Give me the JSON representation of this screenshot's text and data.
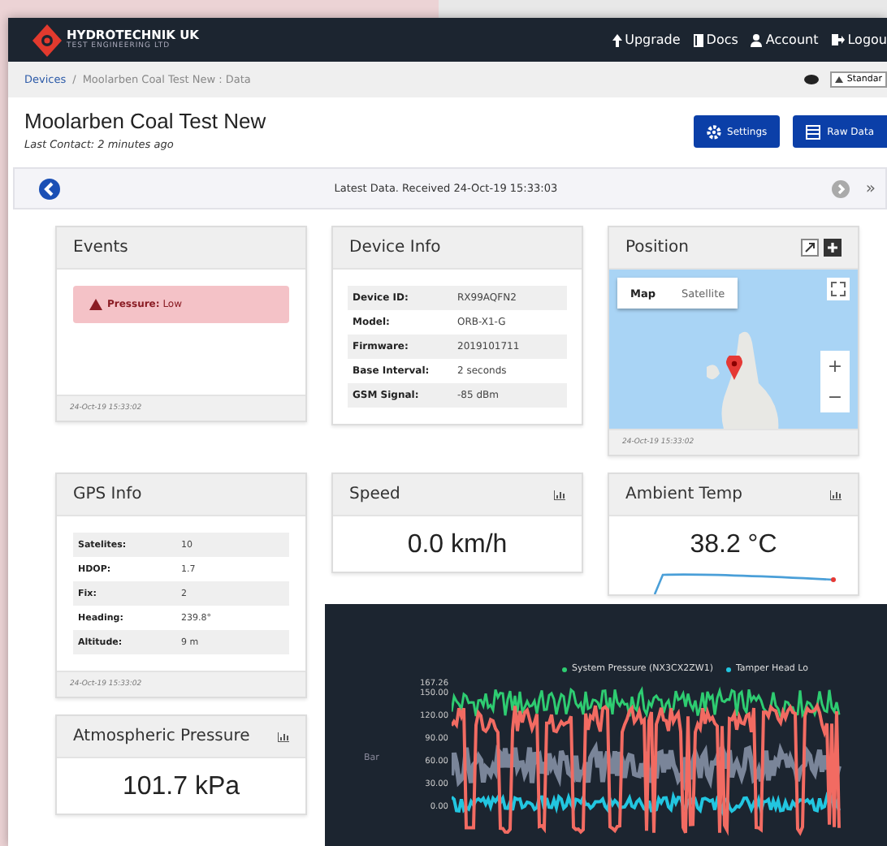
{
  "nav": {
    "brand": "HYDROTECHNIK UK",
    "brand_sub": "TEST ENGINEERING LTD",
    "links": [
      {
        "label": "Upgrade",
        "kind": "upgrade"
      },
      {
        "label": "Docs",
        "kind": "docs"
      },
      {
        "label": "Account",
        "kind": "account"
      },
      {
        "label": "Logou",
        "kind": "logout"
      }
    ]
  },
  "breadcrumb": {
    "items": [
      "Devices",
      "Moolarben Coal Test New : Data"
    ],
    "separator": "/",
    "view_select": "Standar"
  },
  "header": {
    "title": "Moolarben Coal Test New",
    "subtitle": "Last Contact: 2 minutes ago",
    "buttons": [
      {
        "label": "Settings",
        "kind": "settings"
      },
      {
        "label": "Raw Data",
        "kind": "data"
      }
    ]
  },
  "date_nav": {
    "text": "Latest Data. Received 24-Oct-19 15:33:03",
    "next_symbol": "»"
  },
  "events": {
    "title": "Events",
    "alerts": [
      {
        "label": "Pressure:",
        "value": "Low"
      }
    ],
    "footer": "24-Oct-19 15:33:02"
  },
  "device_info": {
    "title": "Device Info",
    "rows": [
      {
        "label": "Device ID:",
        "value": "RX99AQFN2"
      },
      {
        "label": "Model:",
        "value": "ORB-X1-G"
      },
      {
        "label": "Firmware:",
        "value": "2019101711"
      },
      {
        "label": "Base Interval:",
        "value": "2 seconds"
      },
      {
        "label": "GSM Signal:",
        "value": "-85 dBm"
      }
    ]
  },
  "position": {
    "title": "Position",
    "map_types": [
      {
        "label": "Map",
        "selected": true
      },
      {
        "label": "Satellite",
        "selected": false
      }
    ],
    "zoom_in": "+",
    "zoom_out": "−",
    "footer": "24-Oct-19 15:33:02"
  },
  "gps_info": {
    "title": "GPS Info",
    "rows": [
      {
        "label": "Satelites:",
        "value": "10"
      },
      {
        "label": "HDOP:",
        "value": "1.7"
      },
      {
        "label": "Fix:",
        "value": "2"
      },
      {
        "label": "Heading:",
        "value": "239.8°"
      },
      {
        "label": "Altitude:",
        "value": "9 m"
      }
    ],
    "footer": "24-Oct-19 15:33:02"
  },
  "speed": {
    "title": "Speed",
    "value": "0.0 km/h"
  },
  "ambient_temp": {
    "title": "Ambient Temp",
    "value": "38.2 °C"
  },
  "atmospheric_pressure": {
    "title": "Atmospheric Pressure",
    "value": "101.7 kPa"
  },
  "overlay_chart": {
    "legend": [
      {
        "name": "System Pressure  (NX3CX2ZW1)",
        "color": "#2ecc71"
      },
      {
        "name": "Tamper Head Lo",
        "color": "#22c6e0"
      }
    ],
    "ylabel": "Bar",
    "yticks": [
      "167.26",
      "150.00",
      "120.00",
      "90.00",
      "60.00",
      "30.00",
      "0.00"
    ]
  }
}
